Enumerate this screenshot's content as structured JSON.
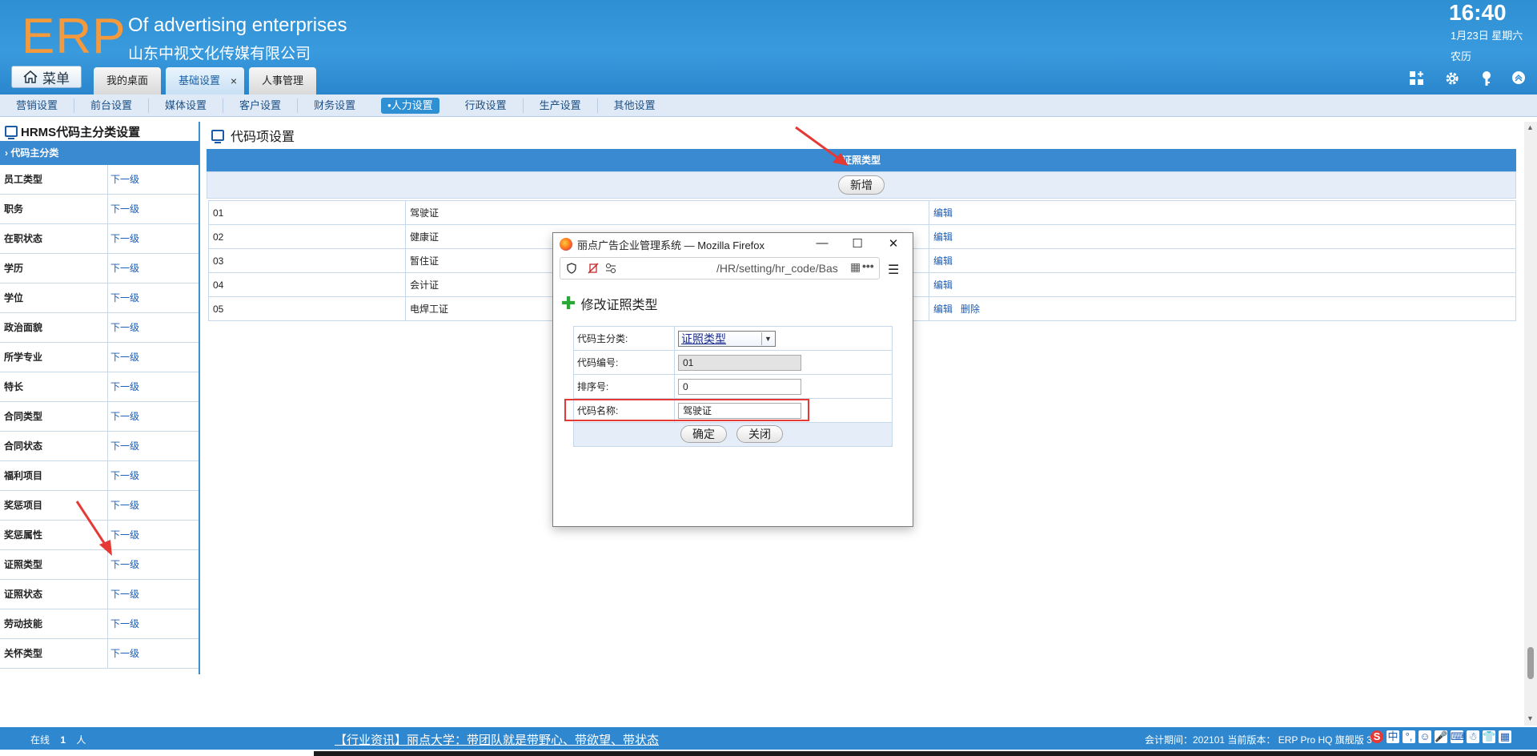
{
  "header": {
    "logo": "ERP",
    "company_en": "Of advertising enterprises",
    "company_cn": "山东中视文化传媒有限公司",
    "time": "16:40",
    "date": "1月23日 星期六",
    "lunar": "农历",
    "menu_label": "菜单",
    "tabs": [
      {
        "label": "我的桌面"
      },
      {
        "label": "基础设置",
        "active": true,
        "close": "×"
      },
      {
        "label": "人事管理"
      }
    ],
    "icons": [
      "apps-icon",
      "gear-icon",
      "key-icon",
      "collapse-up-icon"
    ]
  },
  "subnav": {
    "items": [
      "营销设置",
      "前台设置",
      "媒体设置",
      "客户设置",
      "财务设置",
      "•人力设置",
      "行政设置",
      "生产设置",
      "其他设置"
    ],
    "active_index": 5
  },
  "left_panel": {
    "title": "HRMS代码主分类设置",
    "header": "代码主分类",
    "link_label": "下一级",
    "items": [
      "员工类型",
      "职务",
      "在职状态",
      "学历",
      "学位",
      "政治面貌",
      "所学专业",
      "特长",
      "合同类型",
      "合同状态",
      "福利项目",
      "奖惩项目",
      "奖惩属性",
      "证照类型",
      "证照状态",
      "劳动技能",
      "关怀类型"
    ]
  },
  "main": {
    "title": "代码项设置",
    "header": "证照类型",
    "add_button": "新增",
    "edit_label": "编辑",
    "delete_label": "删除",
    "rows": [
      {
        "code": "01",
        "name": "驾驶证"
      },
      {
        "code": "02",
        "name": "健康证"
      },
      {
        "code": "03",
        "name": "暂住证"
      },
      {
        "code": "04",
        "name": "会计证"
      },
      {
        "code": "05",
        "name": "电焊工证"
      }
    ]
  },
  "popup": {
    "window_title": "丽点广告企业管理系统 — Mozilla Firefox",
    "url": "/HR/setting/hr_code/Bas",
    "url_more": "•••",
    "heading": "修改证照类型",
    "fields": {
      "category_label": "代码主分类:",
      "category_value": "证照类型",
      "code_label": "代码编号:",
      "code_value": "01",
      "order_label": "排序号:",
      "order_value": "0",
      "name_label": "代码名称:",
      "name_value": "驾驶证"
    },
    "confirm_button": "确定",
    "close_button": "关闭"
  },
  "footer": {
    "online_label": "在线",
    "online_count": "1",
    "online_unit": "人",
    "ticker": "【行业资讯】丽点大学：带团队就是带野心、带欲望、带状态",
    "info": "会计期间：202101 当前版本： ERP Pro HQ 旗舰版 3"
  },
  "colors": {
    "header_blue": "#2f8fd3",
    "logo_orange": "#f59a3c",
    "link_blue": "#1b5cb5",
    "highlight_red": "#e53935"
  }
}
